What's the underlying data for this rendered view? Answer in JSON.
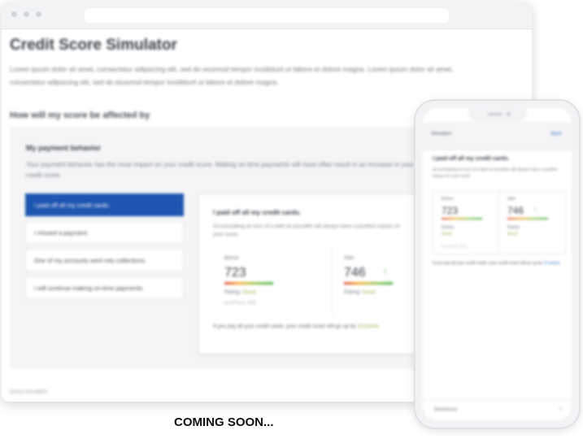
{
  "desktop": {
    "title": "Credit Score Simulator",
    "intro": "Lorem ipsum dolor sit amet, consectetur adipiscing elit, sed do eiusmod tempor incididunt ut labore et dolore magna. Lorem ipsum dolor sit amet, consectetur adipiscing elit, sed do eiusmod tempor incididunt ut labore et dolore magna.",
    "section_title": "How will my score be affected by",
    "behavior": {
      "title": "My payment behavior",
      "description": "Your payment behavior has the most impact on your credit score. Making on-time payments will most often result in an increase in your credit score.",
      "options": [
        "I paid off all my credit cards.",
        "I missed a payment",
        "One of my accounts went into collections.",
        "I will continue making on-time payments."
      ],
      "selected_index": 0
    },
    "result_card": {
      "title": "I paid off all my credit cards.",
      "description": "Accumulating as less of a debt as possible will always have a positive impact on your score.",
      "before": {
        "label": "Before",
        "score": "723",
        "rating_label": "Rating:",
        "rating": "Good",
        "date": "as of Feb 8, 2018"
      },
      "after": {
        "label": "After",
        "score": "746",
        "rating_label": "Rating:",
        "rating": "Good"
      },
      "footer_prefix": "If you pay all your credit cards, your credit score will go up by",
      "footer_points": "23 points"
    },
    "disclosures": "DISCLOSURES"
  },
  "mobile": {
    "header_title": "Simulator",
    "back": "Back",
    "title": "I paid off all my credit cards.",
    "description": "Accumulating as less of a debt as possible will always have a positive impact on your score.",
    "before": {
      "label": "Before",
      "score": "723",
      "rating_label": "Rating:",
      "rating": "Good",
      "date": "as of Feb 8, 2018"
    },
    "after": {
      "label": "After",
      "score": "746",
      "rating_label": "Rating:",
      "rating": "Good"
    },
    "footer_prefix": "If you pay all your credit cards, your credit score will go up by",
    "footer_points": "23 points",
    "disclosures": "Disclosures"
  },
  "caption": "COMING SOON...",
  "colors": {
    "accent": "#1e55b0",
    "positive": "#4caf50",
    "rating": "#8db33c",
    "link": "#3a74c8"
  },
  "icons": {
    "score_change": "arrow-up-icon",
    "disclosure_chevron": "chevron-right-icon"
  }
}
